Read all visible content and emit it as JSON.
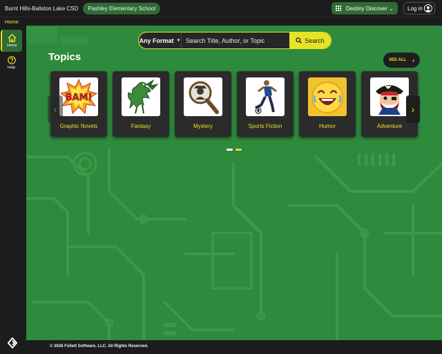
{
  "header": {
    "district": "Burnt Hills-Ballston Lake CSD",
    "school": "Pashley Elementary School",
    "discover_label": "Destiny Discover",
    "login_label": "Log in"
  },
  "breadcrumb": {
    "current": "Home"
  },
  "leftnav": {
    "items": [
      {
        "label": "Home",
        "icon": "home-icon",
        "active": true
      },
      {
        "label": "Help",
        "icon": "help-icon",
        "active": false
      }
    ]
  },
  "search": {
    "format_label": "Any Format",
    "placeholder": "Search Title, Author, or Topic",
    "button_label": "Search"
  },
  "topics": {
    "title": "Topics",
    "see_all_label": "SEE ALL",
    "cards": [
      {
        "name": "Graphic Novels",
        "icon": "bam-comic-icon"
      },
      {
        "name": "Fantasy",
        "icon": "dragon-icon"
      },
      {
        "name": "Mystery",
        "icon": "magnifier-detective-icon"
      },
      {
        "name": "Sports Fiction",
        "icon": "soccer-player-icon"
      },
      {
        "name": "Humor",
        "icon": "laughing-emoji-icon"
      },
      {
        "name": "Adventure",
        "icon": "pirate-icon"
      }
    ],
    "page_count": 2,
    "current_page": 1
  },
  "footer": {
    "copyright": "© 2026 Follett Software, LLC. All Rights Reserved."
  },
  "colors": {
    "accent": "#e7e329",
    "background": "#2e8a3d",
    "dark": "#1c1c1c",
    "pill": "#2f6b34"
  }
}
